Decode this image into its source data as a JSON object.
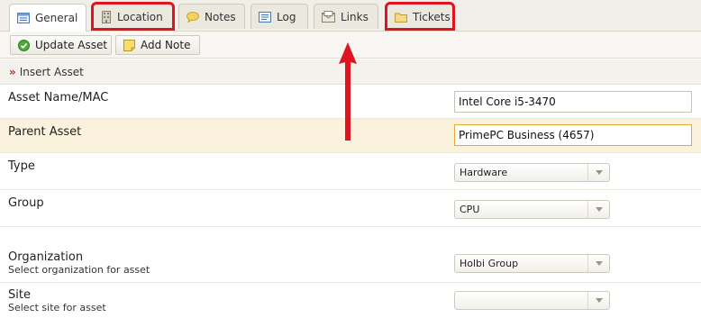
{
  "tabs": [
    {
      "label": "General",
      "icon": "form-icon",
      "active": true
    },
    {
      "label": "Location",
      "icon": "building-icon",
      "highlighted": true
    },
    {
      "label": "Notes",
      "icon": "speech-bubble-icon"
    },
    {
      "label": "Log",
      "icon": "log-icon"
    },
    {
      "label": "Links",
      "icon": "envelope-icon"
    },
    {
      "label": "Tickets",
      "icon": "folder-icon",
      "highlighted": true
    }
  ],
  "toolbar": {
    "update_label": "Update Asset",
    "add_note_label": "Add Note"
  },
  "breadcrumb": {
    "label": "Insert Asset"
  },
  "form": {
    "asset_name": {
      "label": "Asset Name/MAC",
      "value": "Intel Core i5-3470"
    },
    "parent_asset": {
      "label": "Parent Asset",
      "value": "PrimePC Business (4657)"
    },
    "type": {
      "label": "Type",
      "value": "Hardware"
    },
    "group": {
      "label": "Group",
      "value": "CPU"
    },
    "organization": {
      "label": "Organization",
      "hint": "Select organization for asset",
      "value": "Holbi Group"
    },
    "site": {
      "label": "Site",
      "hint": "Select site for asset",
      "value": ""
    }
  },
  "colors": {
    "highlight_box": "#e0141e",
    "annotation_arrow": "#e0141e",
    "focused_row": "#fbf2dd",
    "breadcrumb_arrow": "#b5302a"
  }
}
